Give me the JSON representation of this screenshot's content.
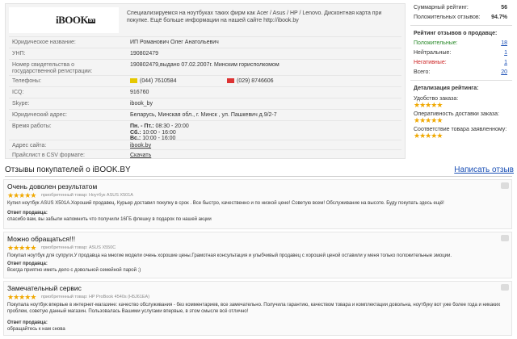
{
  "shop": {
    "logo_text": "iBOOK",
    "logo_suffix": "BY",
    "description": "Специализируемся на ноутбуках таких фирм как Acer / Asus / HP / Lenovo. Дисконтная карта при покупке. Ещё больше информации на нашей сайте http://ibook.by",
    "rows": [
      {
        "label": "Юридическое название:",
        "value": "ИП Романович Олег Анатольевич"
      },
      {
        "label": "УНП:",
        "value": "190802479"
      },
      {
        "label": "Номер свидетельства о государственной регистрации:",
        "value": "190802479,выдано 07.02.2007г. Минским горисполкомом"
      }
    ],
    "phones_label": "Телефоны:",
    "phone1": "(044) 7610584",
    "phone2": "(029) 8746606",
    "icq_label": "ICQ:",
    "icq": "916760",
    "skype_label": "Skype:",
    "skype": "ibook_by",
    "address_label": "Юридический адрес:",
    "address": "Беларусь, Минская обл., г. Минск , ул. Пашкевич д.9/2-7",
    "hours_label": "Время работы:",
    "hours": [
      {
        "days": "Пн. - Пт.:",
        "time": "08:30 - 20:00"
      },
      {
        "days": "Сб.:",
        "time": "10:00 - 16:00"
      },
      {
        "days": "Вс.:",
        "time": "10:00 - 16:00"
      }
    ],
    "site_label": "Адрес сайта:",
    "site": "ibook.by",
    "pricelist_label": "Прайслист в CSV формате:",
    "pricelist": "Скачать"
  },
  "ratings": {
    "summary_label": "Суммарный рейтинг:",
    "summary_value": "56",
    "positive_pct_label": "Положительных отзывов:",
    "positive_pct_value": "94.7%",
    "seller_title": "Рейтинг отзывов о продавце:",
    "positive_label": "Положительные:",
    "positive_value": "18",
    "neutral_label": "Нейтральные:",
    "neutral_value": "1",
    "negative_label": "Негативные:",
    "negative_value": "1",
    "total_label": "Всего:",
    "total_value": "20",
    "detail_title": "Детализация рейтинга:",
    "details": [
      {
        "label": "Удобство заказа:",
        "stars": 5
      },
      {
        "label": "Оперативность доставки заказа:",
        "stars": 5
      },
      {
        "label": "Соответствие товара заявленному:",
        "stars": 5
      }
    ]
  },
  "reviews_header": {
    "title": "Отзывы покупателей о iBOOK.BY",
    "write_link": "Написать отзыв"
  },
  "reviews": [
    {
      "title": "Очень доволен результатом",
      "stars": 5,
      "product": "приобретенный товар: Ноутбук ASUS X501A",
      "body": "Купил ноутбук ASUS X501A.Хороший продавец. Курьер доставил покупку в срок . Все быстро, качественно и по низкой цене! Советую всем! Обслуживание на высоте. Буду покупать здесь ещё!",
      "seller_label": "Ответ продавца:",
      "seller_text": "спасибо вам, вы забыли напомнить что получили 16ГБ флешку в подарок по нашей акции"
    },
    {
      "title": "Можно обращаться!!!",
      "stars": 5,
      "product": "приобретенный товар: ASUS X550C",
      "body": "Покупал ноутбук для супруги.У продавца на многие модели очень хорошие цены.Грамотная консультация и улыбчивый продавец с хорошей ценой оставили у меня только положительные эмоции.",
      "seller_label": "Ответ продавца:",
      "seller_text": "Всегда приятно иметь дело с довольной семейной парой ;)"
    },
    {
      "title": "Замечательный сервис",
      "stars": 5,
      "product": "приобретенный товар: HP ProBook 4540s (H5J61EA)",
      "body": "Покупала ноутбук впервые в интернет-магазине: качество обслуживания - без комментариев, все замечательно. Получила гарантию, качеством товара и комплектации довольна, ноутбуку вот уже более года и никаких проблем, советую данный магазин. Пользовалась Вашими услугами впервые, в этом смысле всё отлично!",
      "seller_label": "Ответ продавца:",
      "seller_text": "обращайтесь к нам снова"
    }
  ]
}
